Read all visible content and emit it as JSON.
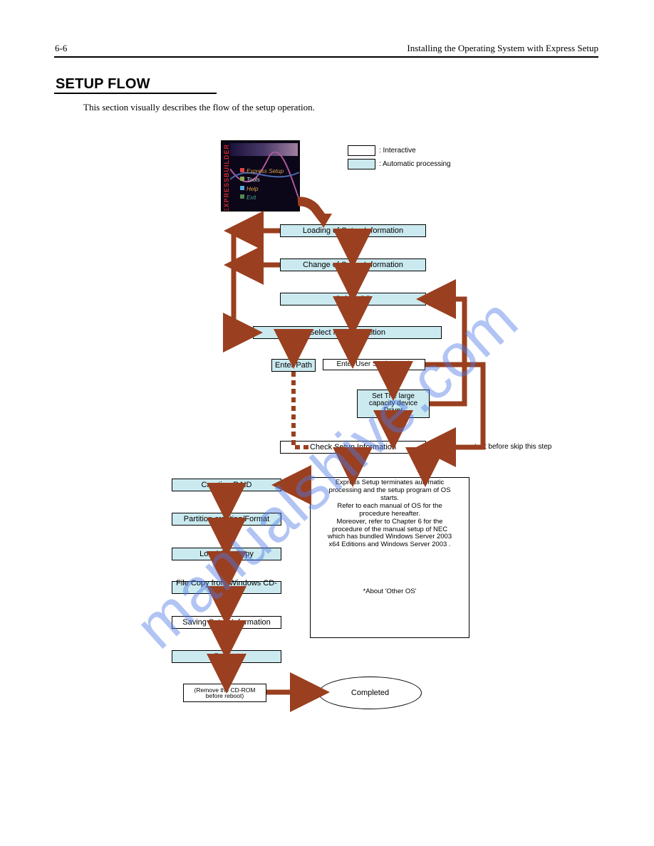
{
  "header": {
    "left": "6-6",
    "right": "Installing the Operating System with Express Setup"
  },
  "section_title": "SETUP FLOW",
  "intro": "This section visually describes the flow of the setup operation.",
  "legend": {
    "interactive": ": Interactive",
    "auto": ": Automatic processing"
  },
  "app": {
    "sidebar": "EXPRESSBUILDER",
    "menu": [
      "Express Setup",
      "Tools",
      "Help",
      "Exit"
    ]
  },
  "flow": {
    "load_config": "Loading of Setup Information",
    "change_config": "Change of Setup Information",
    "select_os": "Select OS",
    "select_media": "Select Media/Partition",
    "enter_path": "Enter Path",
    "enter_user_path": "Enter User Setting Path",
    "set_large_driver": "Set The large capacity device Driver",
    "check_setup": "Check Setup Information",
    "creating_raid": "Creating RAID",
    "partition_format": "Partition creating/Format",
    "local_file_copy": "Local File Copy",
    "file_copy_cd": "File Copy from Windows CD-ROM",
    "saving_setup": "Saving Setup Information",
    "reboot": "Reboot",
    "completed": "Completed"
  },
  "auto_box": {
    "lines": [
      "Express Setup terminates automatic",
      "processing and the setup program of OS",
      "starts.",
      "",
      "Refer to each manual of OS for the",
      "procedure hereafter.",
      "",
      "Moreover, refer to Chapter 6 for the",
      "procedure of the manual setup of NEC",
      "which has bundled Windows Server 2003",
      "x64 Editions and Windows Server 2003 .",
      "",
      "",
      "",
      "",
      "",
      "*About 'Other OS'"
    ]
  },
  "notes": {
    "check_skip": "Check the content before skip this step",
    "reboot_hint": "(Remove the CD-ROM before reboot)"
  },
  "watermark": "manualshive.com"
}
